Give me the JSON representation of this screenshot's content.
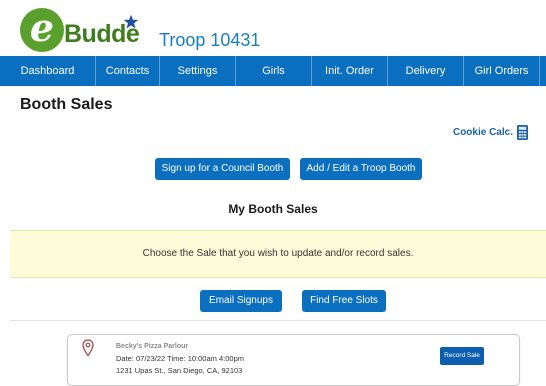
{
  "brand": {
    "logo_letter": "e",
    "logo_word": "Budde",
    "troop_label": "Troop 10431"
  },
  "nav": {
    "items": [
      {
        "label": "Dashboard"
      },
      {
        "label": "Contacts"
      },
      {
        "label": "Settings"
      },
      {
        "label": "Girls"
      },
      {
        "label": "Init. Order"
      },
      {
        "label": "Delivery"
      },
      {
        "label": "Girl Orders"
      }
    ]
  },
  "page": {
    "title": "Booth Sales"
  },
  "tools": {
    "cookie_calc_label": "Cookie Calc."
  },
  "actions": {
    "council_booth_label": "Sign up for a Council Booth",
    "troop_booth_label": "Add / Edit a Troop Booth",
    "email_signups_label": "Email Signups",
    "find_slots_label": "Find Free Slots"
  },
  "my_booth_sales": {
    "heading": "My Booth Sales",
    "notice": "Choose the Sale that you wish to update and/or record sales."
  },
  "booths": [
    {
      "name": "Becky's Pizza Parlour",
      "date_time": "Date: 07/23/22  Time: 10:00am 4:00pm",
      "address": "1231 Upas St., San Diego, CA, 92103",
      "record_label": "Record Sale"
    }
  ],
  "colors": {
    "nav_blue": "#0b6fc0",
    "brand_green": "#5aa02c",
    "troop_blue": "#1a7dc4",
    "notice_yellow": "#fdfbd8"
  }
}
